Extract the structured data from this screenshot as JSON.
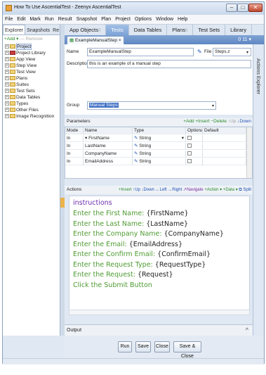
{
  "window": {
    "title": "How To Use AscentialTest - Zeenyx AscentialTest",
    "buttons": {
      "minimize": "–",
      "maximize": "□",
      "close": "✕"
    }
  },
  "menu": [
    "File",
    "Edit",
    "Mark",
    "Run",
    "Result",
    "Snapshot",
    "Plan",
    "Project",
    "Options",
    "Window",
    "Help"
  ],
  "left_panel": {
    "tabs": [
      "Explorer",
      "Snapshots",
      "Re"
    ],
    "add_label": "+Add ▾",
    "remove_label": "— Remove",
    "tree": [
      {
        "label": "Project",
        "icon": "folder-icon",
        "selected": true
      },
      {
        "label": "Project Library",
        "icon": "library-icon",
        "selected": false
      },
      {
        "label": "App View",
        "icon": "folder-icon",
        "selected": false
      },
      {
        "label": "Step View",
        "icon": "folder-icon",
        "selected": false
      },
      {
        "label": "Test View",
        "icon": "folder-icon",
        "selected": false
      },
      {
        "label": "Plans",
        "icon": "folder-icon",
        "selected": false
      },
      {
        "label": "Suites",
        "icon": "folder-icon",
        "selected": false
      },
      {
        "label": "Test Sets",
        "icon": "folder-icon",
        "selected": false
      },
      {
        "label": "Data Tables",
        "icon": "folder-icon",
        "selected": false
      },
      {
        "label": "Types",
        "icon": "folder-icon",
        "selected": false
      },
      {
        "label": "Other Files",
        "icon": "folder-icon",
        "selected": false
      },
      {
        "label": "Image Recognition",
        "icon": "folder-icon",
        "selected": false
      }
    ]
  },
  "main_tabs": [
    {
      "label": "App Objects",
      "badge": "0",
      "active": false
    },
    {
      "label": "Tests",
      "badge": "",
      "active": true
    },
    {
      "label": "Data Tables",
      "badge": "",
      "active": false
    },
    {
      "label": "Plans",
      "badge": "0",
      "active": false
    },
    {
      "label": "Test Sets",
      "badge": "",
      "active": false
    },
    {
      "label": "Library",
      "badge": "",
      "active": false
    }
  ],
  "doc_tab": {
    "label": "ExampleManualStep",
    "close": "×",
    "right_controls": "0 11 ▾"
  },
  "explorer_strip": "Actions Explorer",
  "props": {
    "name_label": "Name",
    "name_value": "ExampleManualStep",
    "file_label": "File",
    "file_value": "Steps.z",
    "description_label": "Description",
    "description_value": "this is an example of a manual step",
    "group_label": "Group",
    "group_value": "Manual Steps"
  },
  "parameters": {
    "title": "Parameters",
    "toolbar": {
      "add": "+Add",
      "insert": "+Insert",
      "delete": "−Delete",
      "up": "↑Up",
      "down": "↓Down"
    },
    "columns": [
      "Mode",
      "Name",
      "Type",
      "Optional",
      "Default"
    ],
    "rows": [
      {
        "mode": "In",
        "name": "FirstName",
        "type": "String",
        "optional": false,
        "default": ""
      },
      {
        "mode": "In",
        "name": "LastName",
        "type": "String",
        "optional": false,
        "default": ""
      },
      {
        "mode": "In",
        "name": "CompanyName",
        "type": "String",
        "optional": false,
        "default": ""
      },
      {
        "mode": "In",
        "name": "EmailAddress",
        "type": "String",
        "optional": false,
        "default": ""
      }
    ]
  },
  "actions": {
    "title": "Actions",
    "toolbar": {
      "insert": "+Insert",
      "up": "↑Up",
      "down": "↓Down",
      "left": "←Left",
      "right": "→Right",
      "navigate": "↗Navigate",
      "action": "+Action ▾",
      "data": "+Data ▾",
      "split": "⧉ Split"
    },
    "heading": "instructions",
    "lines": [
      {
        "text": "Enter the First Name: ",
        "var": "{FirstName}"
      },
      {
        "text": "Enter the Last Name: ",
        "var": "{LastName}"
      },
      {
        "text": "Enter the Company Name: ",
        "var": "{CompanyName}"
      },
      {
        "text": "Enter the Email: ",
        "var": "{EmailAddress}"
      },
      {
        "text": "Enter the Confirm Email: ",
        "var": "{ConfirmEmail}"
      },
      {
        "text": "Enter the Request Type: ",
        "var": "{RequestType}"
      },
      {
        "text": "Enter the Request: ",
        "var": "{Request}"
      },
      {
        "text": "Click the Submit Button",
        "var": ""
      }
    ]
  },
  "output": {
    "label": "Output",
    "caret": "^"
  },
  "buttons": {
    "run": "Run",
    "save": "Save",
    "close": "Close",
    "save_close": "Save & Close"
  },
  "colors": {
    "active_tab": "#7ea3d6",
    "action_text": "#4f9b33",
    "action_heading": "#6d2fb2",
    "selection": "#3e6fc4"
  }
}
